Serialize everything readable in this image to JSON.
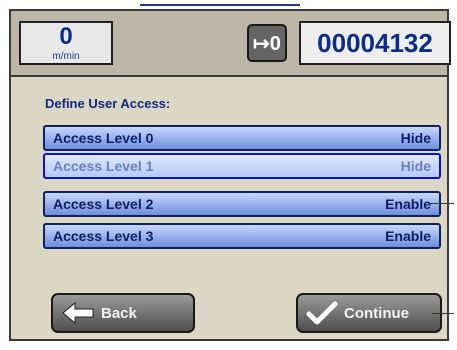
{
  "header": {
    "rate_value": "0",
    "rate_unit": "m/min",
    "reset_glyph": "↦0",
    "counter": "00004132"
  },
  "section_title": "Define User Access:",
  "access_levels": [
    {
      "label": "Access Level 0",
      "value": "Hide"
    },
    {
      "label": "Access Level 1",
      "value": "Hide"
    },
    {
      "label": "Access Level 2",
      "value": "Enable"
    },
    {
      "label": "Access Level 3",
      "value": "Enable"
    }
  ],
  "buttons": {
    "back": "Back",
    "continue": "Continue"
  },
  "icons": {
    "reset": "reset-counter-icon",
    "back": "arrow-left-icon",
    "continue": "checkmark-icon"
  },
  "colors": {
    "background": "#dcd7c5",
    "row_gradient_top": "#c7d6fb",
    "row_gradient_bottom": "#6e8fe0",
    "text_blue": "#0a2c8c"
  },
  "selected_index": 1
}
